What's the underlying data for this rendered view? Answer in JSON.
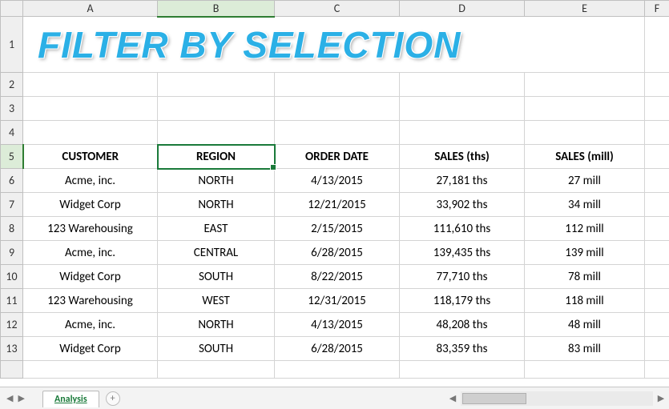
{
  "title": "FILTER BY SELECTION",
  "columns": [
    "A",
    "B",
    "C",
    "D",
    "E",
    "F"
  ],
  "active_cell": "B5",
  "sheet_tab": "Analysis",
  "headers": {
    "customer": "CUSTOMER",
    "region": "REGION",
    "order_date": "ORDER DATE",
    "sales_ths": "SALES (ths)",
    "sales_mill": "SALES (mill)"
  },
  "rows": [
    {
      "customer": "Acme, inc.",
      "region": "NORTH",
      "order_date": "4/13/2015",
      "sales_ths": "27,181 ths",
      "sales_mill": "27 mill"
    },
    {
      "customer": "Widget Corp",
      "region": "NORTH",
      "order_date": "12/21/2015",
      "sales_ths": "33,902 ths",
      "sales_mill": "34 mill"
    },
    {
      "customer": "123 Warehousing",
      "region": "EAST",
      "order_date": "2/15/2015",
      "sales_ths": "111,610 ths",
      "sales_mill": "112 mill"
    },
    {
      "customer": "Acme, inc.",
      "region": "CENTRAL",
      "order_date": "6/28/2015",
      "sales_ths": "139,435 ths",
      "sales_mill": "139 mill"
    },
    {
      "customer": "Widget Corp",
      "region": "SOUTH",
      "order_date": "8/22/2015",
      "sales_ths": "77,710 ths",
      "sales_mill": "78 mill"
    },
    {
      "customer": "123 Warehousing",
      "region": "WEST",
      "order_date": "12/31/2015",
      "sales_ths": "118,179 ths",
      "sales_mill": "118 mill"
    },
    {
      "customer": "Acme, inc.",
      "region": "NORTH",
      "order_date": "4/13/2015",
      "sales_ths": "48,208 ths",
      "sales_mill": "48 mill"
    },
    {
      "customer": "Widget Corp",
      "region": "SOUTH",
      "order_date": "6/28/2015",
      "sales_ths": "83,359 ths",
      "sales_mill": "83 mill"
    }
  ]
}
